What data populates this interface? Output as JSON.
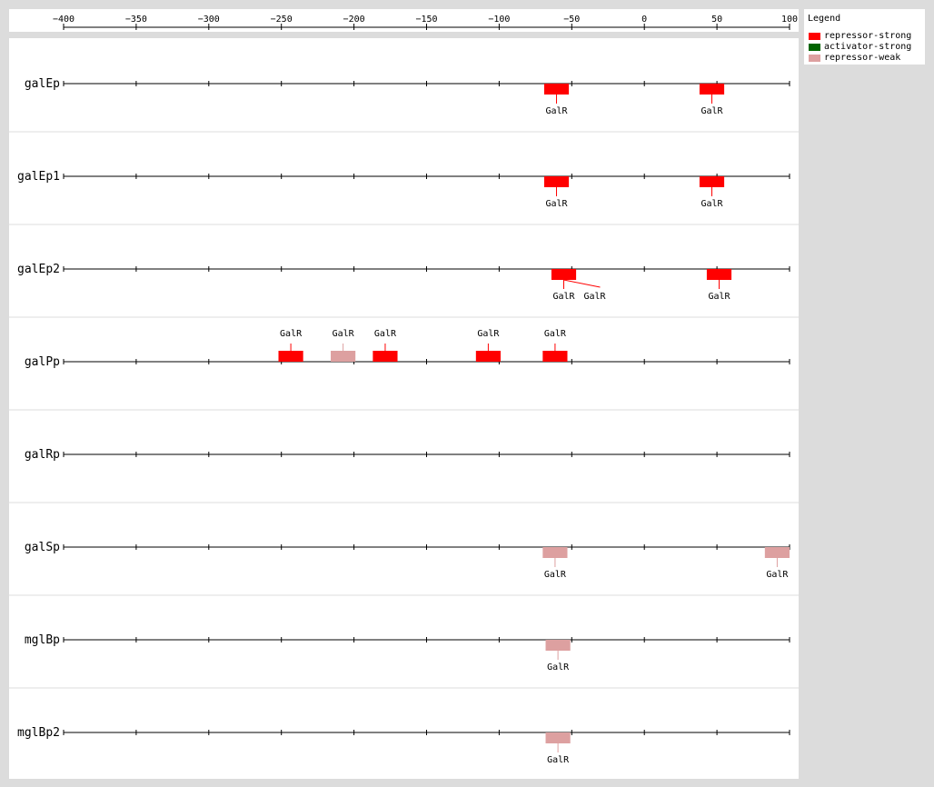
{
  "axis": {
    "ticks": [
      -400,
      -350,
      -300,
      -250,
      -200,
      -150,
      -100,
      -50,
      0,
      50,
      100
    ],
    "min": -400,
    "max": 100
  },
  "legend": {
    "title": "Legend",
    "items": [
      {
        "label": "repressor-strong",
        "color": "#ff0000"
      },
      {
        "label": "activator-strong",
        "color": "#006400"
      },
      {
        "label": "repressor-weak",
        "color": "#dda0a0"
      }
    ]
  },
  "colors": {
    "repressor-strong": "#ff0000",
    "activator-strong": "#006400",
    "repressor-weak": "#dda0a0"
  },
  "tracks": [
    {
      "name": "galEp",
      "sites": [
        {
          "label": "GalR",
          "start": -69,
          "end": -52,
          "type": "repressor-strong",
          "side": "below"
        },
        {
          "label": "GalR",
          "start": 38,
          "end": 55,
          "type": "repressor-strong",
          "side": "below"
        }
      ]
    },
    {
      "name": "galEp1",
      "sites": [
        {
          "label": "GalR",
          "start": -69,
          "end": -52,
          "type": "repressor-strong",
          "side": "below"
        },
        {
          "label": "GalR",
          "start": 38,
          "end": 55,
          "type": "repressor-strong",
          "side": "below"
        }
      ]
    },
    {
      "name": "galEp2",
      "sites": [
        {
          "label": "GalR",
          "start": -64,
          "end": -47,
          "type": "repressor-strong",
          "side": "below"
        },
        {
          "label": "GalR",
          "start": -64,
          "end": -47,
          "type": "repressor-strong",
          "side": "below",
          "offset": 40
        },
        {
          "label": "GalR",
          "start": 43,
          "end": 60,
          "type": "repressor-strong",
          "side": "below"
        }
      ]
    },
    {
      "name": "galPp",
      "sites": [
        {
          "label": "GalR",
          "start": -252,
          "end": -235,
          "type": "repressor-strong",
          "side": "above"
        },
        {
          "label": "GalR",
          "start": -216,
          "end": -199,
          "type": "repressor-weak",
          "side": "above"
        },
        {
          "label": "GalR",
          "start": -187,
          "end": -170,
          "type": "repressor-strong",
          "side": "above"
        },
        {
          "label": "GalR",
          "start": -116,
          "end": -99,
          "type": "repressor-strong",
          "side": "above"
        },
        {
          "label": "GalR",
          "start": -70,
          "end": -53,
          "type": "repressor-strong",
          "side": "above"
        }
      ]
    },
    {
      "name": "galRp",
      "sites": []
    },
    {
      "name": "galSp",
      "sites": [
        {
          "label": "GalR",
          "start": -70,
          "end": -53,
          "type": "repressor-weak",
          "side": "below"
        },
        {
          "label": "GalR",
          "start": 83,
          "end": 100,
          "type": "repressor-weak",
          "side": "below"
        }
      ]
    },
    {
      "name": "mglBp",
      "sites": [
        {
          "label": "GalR",
          "start": -68,
          "end": -51,
          "type": "repressor-weak",
          "side": "below"
        }
      ]
    },
    {
      "name": "mglBp2",
      "sites": [
        {
          "label": "GalR",
          "start": -68,
          "end": -51,
          "type": "repressor-weak",
          "side": "below"
        }
      ]
    }
  ]
}
